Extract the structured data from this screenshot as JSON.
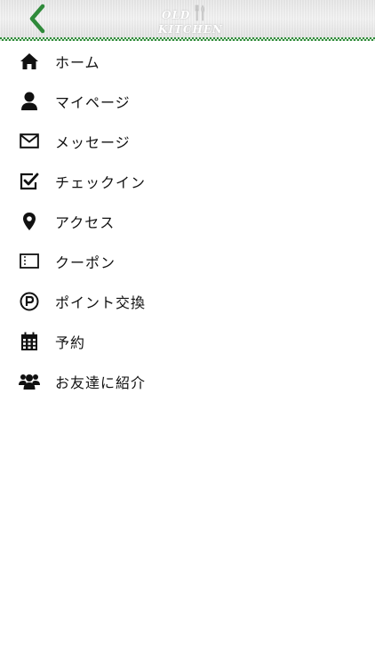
{
  "header": {
    "logo_line1": "OLD",
    "logo_line2": "KITCHEN",
    "back_icon": "chevron-left-icon",
    "accent_color": "#2f8a3a"
  },
  "menu": {
    "items": [
      {
        "label": "ホーム",
        "icon": "home-icon"
      },
      {
        "label": "マイページ",
        "icon": "user-icon"
      },
      {
        "label": "メッセージ",
        "icon": "envelope-icon"
      },
      {
        "label": "チェックイン",
        "icon": "checkbox-icon"
      },
      {
        "label": "アクセス",
        "icon": "map-pin-icon"
      },
      {
        "label": "クーポン",
        "icon": "coupon-icon"
      },
      {
        "label": "ポイント交換",
        "icon": "point-icon"
      },
      {
        "label": "予約",
        "icon": "calendar-icon"
      },
      {
        "label": "お友達に紹介",
        "icon": "users-icon"
      }
    ]
  }
}
